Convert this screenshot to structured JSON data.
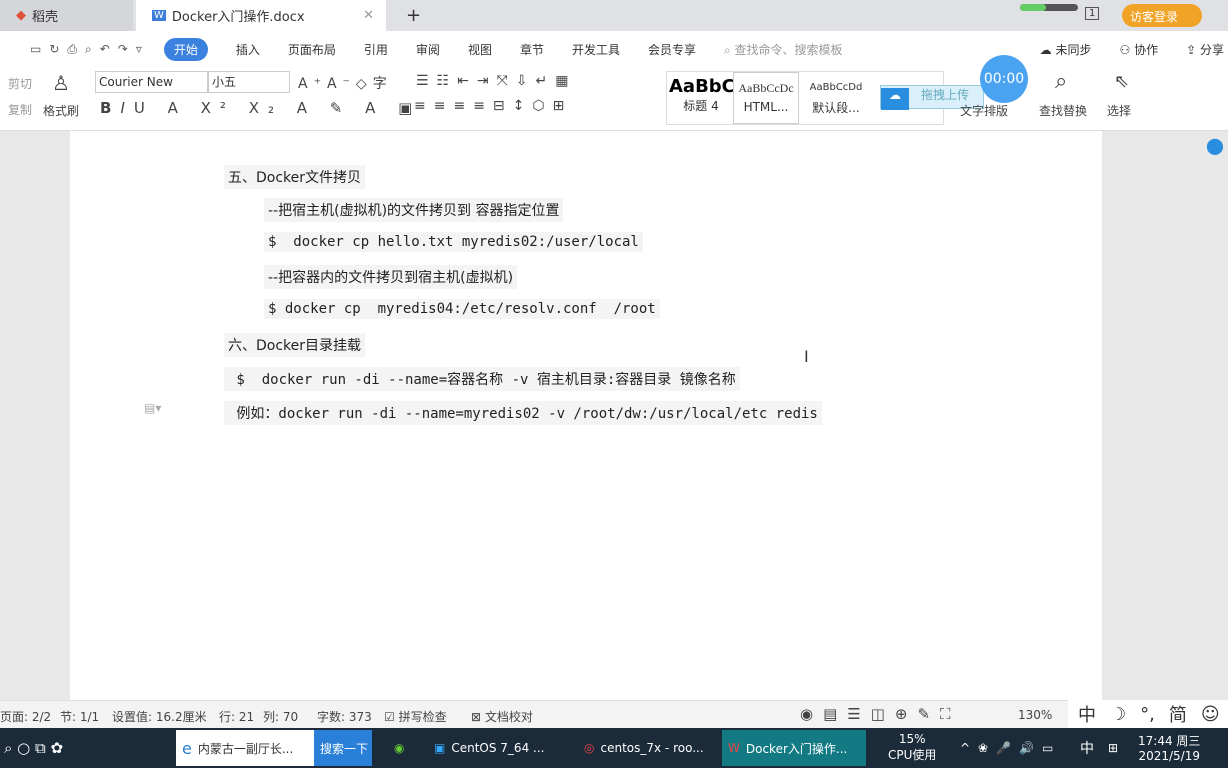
{
  "tabs": [
    {
      "label": "稻壳"
    },
    {
      "label": "Docker入门操作.docx"
    }
  ],
  "login_label": "访客登录",
  "page_indicator": "1",
  "menu": {
    "items": [
      "开始",
      "插入",
      "页面布局",
      "引用",
      "审阅",
      "视图",
      "章节",
      "开发工具",
      "会员专享"
    ],
    "search_placeholder": "查找命令、搜索模板",
    "sync": "未同步",
    "collab": "协作",
    "share": "分享"
  },
  "toolbar": {
    "cut": "剪切",
    "copy": "复制",
    "format_painter": "格式刷",
    "font": "Courier New",
    "size": "小五",
    "styles": [
      {
        "preview": "AaBbC",
        "label": "标题 4"
      },
      {
        "preview": "AaBbCcDc",
        "label": "HTML..."
      },
      {
        "preview": "AaBbCcDd",
        "label": "默认段..."
      }
    ],
    "upload": "拖拽上传",
    "timer": "00:00",
    "text_layout": "文字排版",
    "find_replace": "查找替换",
    "select": "选择"
  },
  "document": {
    "lines": [
      "五、Docker文件拷贝",
      "--把宿主机(虚拟机)的文件拷贝到 容器指定位置",
      "$  docker cp hello.txt myredis02:/user/local",
      "--把容器内的文件拷贝到宿主机(虚拟机)",
      "$ docker cp  myredis04:/etc/resolv.conf  /root",
      "六、Docker目录挂载",
      " $  docker run -di --name=容器名称 -v 宿主机目录:容器目录 镜像名称",
      " 例如：docker run -di --name=myredis02 -v /root/dw:/usr/local/etc redis"
    ]
  },
  "status": {
    "page": "页面: 2/2",
    "section": "节: 1/1",
    "setting": "设置值: 16.2厘米",
    "row": "行: 21",
    "col": "列: 70",
    "words": "字数: 373",
    "spell": "拼写检查",
    "proof": "文档校对",
    "zoom": "130%",
    "ime": [
      "中",
      "°,",
      "简"
    ]
  },
  "taskbar": {
    "search_text": "内蒙古一副厅长...",
    "search_btn": "搜索一下",
    "apps": [
      "CentOS 7_64 ...",
      "centos_7x - roo...",
      "Docker入门操作..."
    ],
    "cpu": "15%",
    "cpu_label": "CPU使用",
    "ime": "中",
    "time": "17:44 周三",
    "date": "2021/5/19"
  }
}
